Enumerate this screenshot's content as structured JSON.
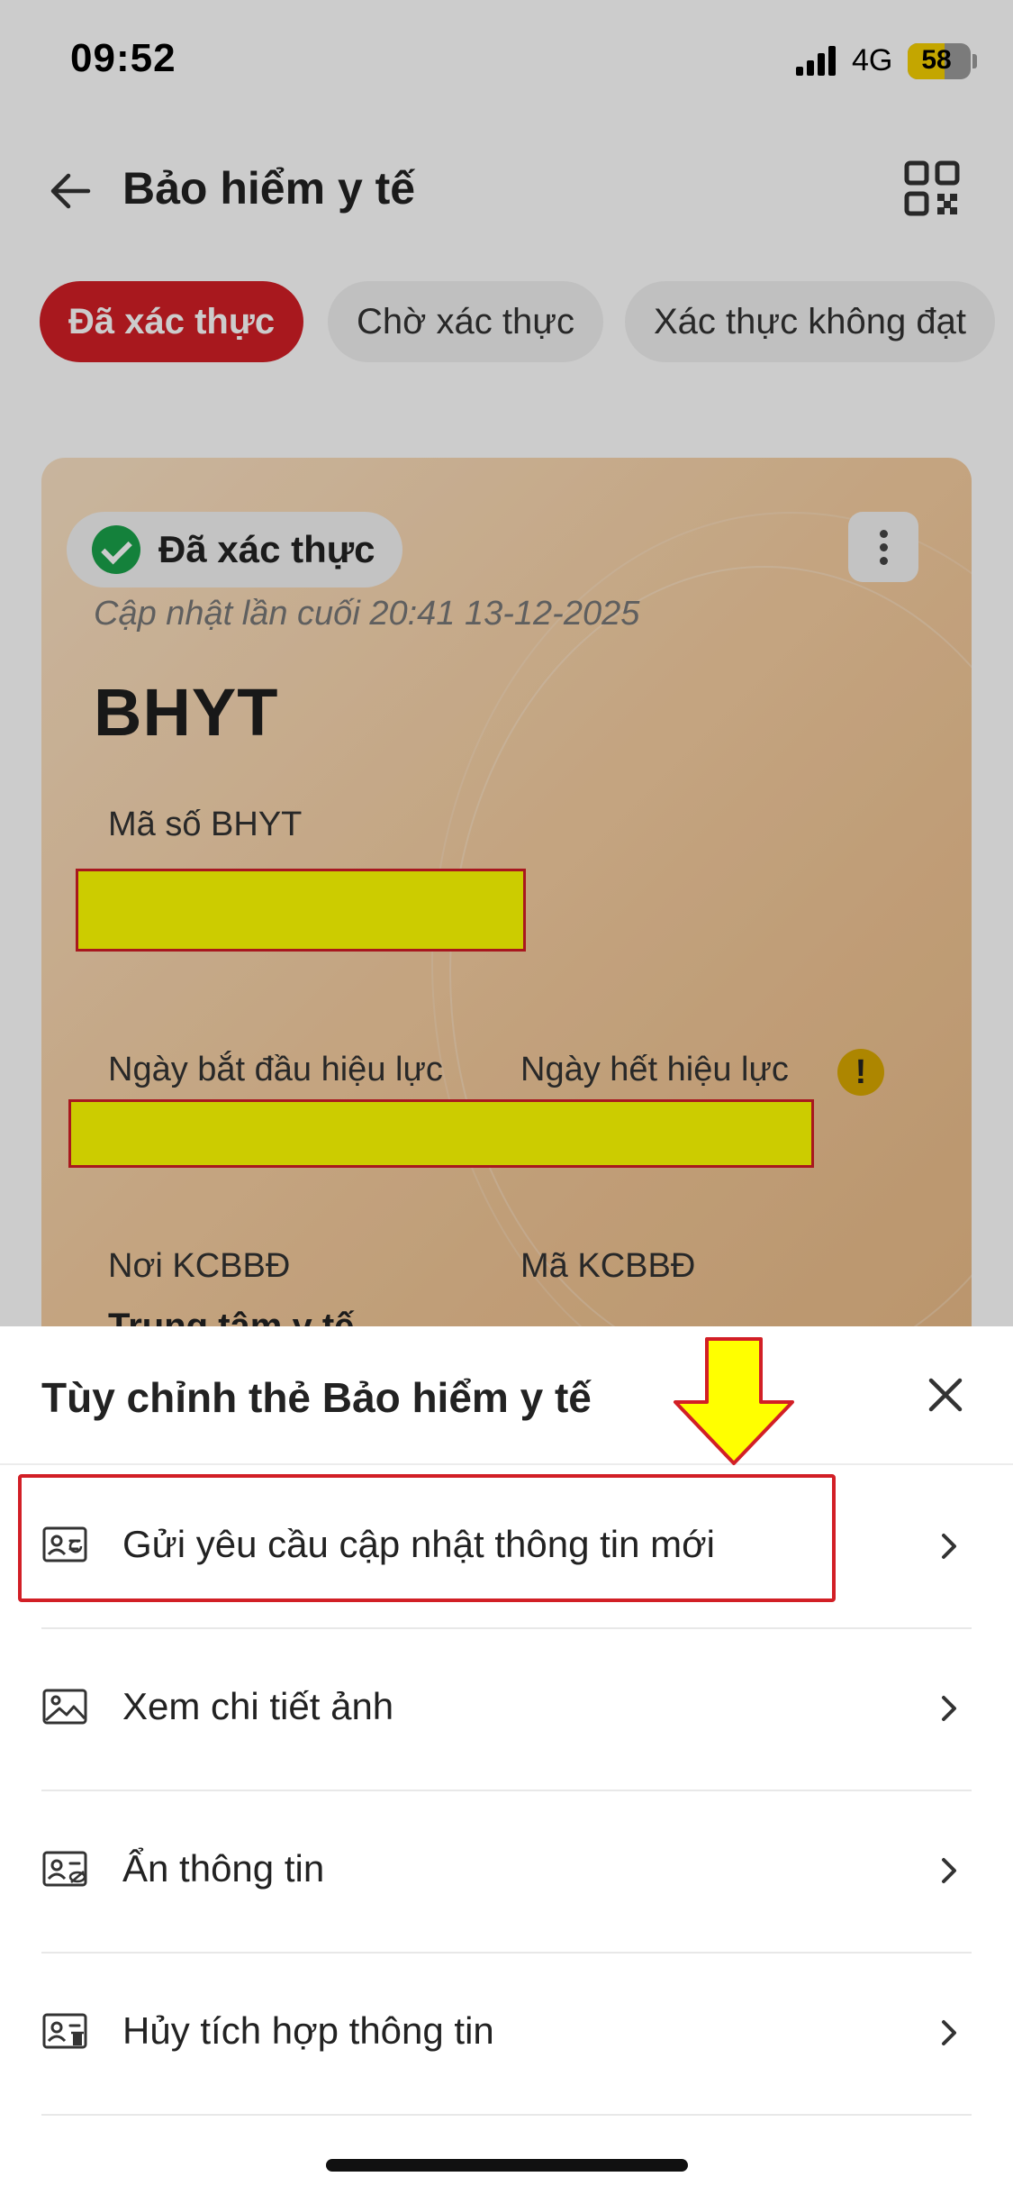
{
  "status_bar": {
    "time": "09:52",
    "network": "4G",
    "battery": "58",
    "battery_level_percent": 58
  },
  "header": {
    "title": "Bảo hiểm y tế",
    "back_icon": "arrow-left-icon",
    "qr_icon": "qr-code-icon"
  },
  "tabs": [
    {
      "label": "Đã xác thực",
      "active": true
    },
    {
      "label": "Chờ xác thực",
      "active": false
    },
    {
      "label": "Xác thực không đạt",
      "active": false
    }
  ],
  "card": {
    "status_label": "Đã xác thực",
    "last_updated": "Cập nhật lần cuối 20:41 13-12-2025",
    "name": "BHYT",
    "fields": {
      "id_label": "Mã số BHYT",
      "start_label": "Ngày bắt đầu hiệu lực",
      "end_label": "Ngày hết hiệu lực",
      "warning_glyph": "!",
      "place_label": "Nơi KCBBĐ",
      "code_label": "Mã KCBBĐ",
      "place_value": "Trung tâm y tế"
    }
  },
  "sheet": {
    "title": "Tùy chỉnh thẻ Bảo hiểm y tế",
    "close_icon": "close-icon",
    "items": [
      {
        "label": "Gửi yêu cầu cập nhật thông tin mới",
        "icon": "id-card-refresh-icon"
      },
      {
        "label": "Xem chi tiết ảnh",
        "icon": "image-icon"
      },
      {
        "label": "Ẩn thông tin",
        "icon": "id-card-hide-icon"
      },
      {
        "label": "Hủy tích hợp thông tin",
        "icon": "id-card-delete-icon"
      }
    ]
  },
  "colors": {
    "accent": "#d21f26",
    "verified": "#1aa24a",
    "highlight": "#ffff00"
  }
}
